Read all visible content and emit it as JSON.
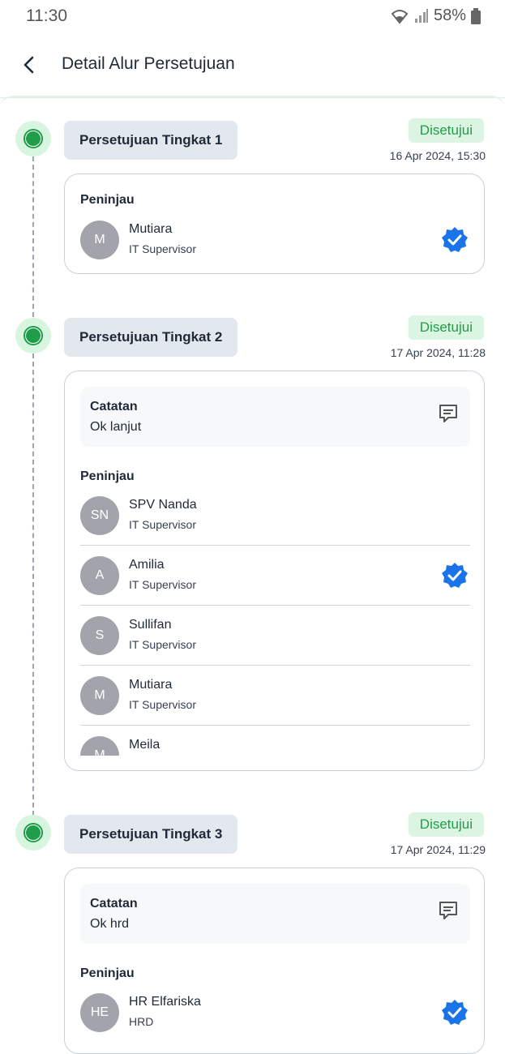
{
  "status_bar": {
    "time": "11:30",
    "battery": "58%"
  },
  "header": {
    "title": "Detail Alur Persetujuan"
  },
  "levels": [
    {
      "title": "Persetujuan Tingkat 1",
      "status": "Disetujui",
      "timestamp": "16 Apr 2024, 15:30",
      "reviewers_label": "Peninjau",
      "reviewers": [
        {
          "initials": "M",
          "name": "Mutiara",
          "role": "IT Supervisor",
          "approved": true
        }
      ]
    },
    {
      "title": "Persetujuan Tingkat 2",
      "status": "Disetujui",
      "timestamp": "17 Apr 2024, 11:28",
      "note_label": "Catatan",
      "note": "Ok lanjut",
      "reviewers_label": "Peninjau",
      "reviewers": [
        {
          "initials": "SN",
          "name": "SPV Nanda",
          "role": "IT Supervisor",
          "approved": false
        },
        {
          "initials": "A",
          "name": "Amilia",
          "role": "IT Supervisor",
          "approved": true
        },
        {
          "initials": "S",
          "name": "Sullifan",
          "role": "IT Supervisor",
          "approved": false
        },
        {
          "initials": "M",
          "name": "Mutiara",
          "role": "IT Supervisor",
          "approved": false
        },
        {
          "initials": "M",
          "name": "Meila",
          "role": "",
          "approved": false
        }
      ]
    },
    {
      "title": "Persetujuan Tingkat 3",
      "status": "Disetujui",
      "timestamp": "17 Apr 2024, 11:29",
      "note_label": "Catatan",
      "note": "Ok hrd",
      "reviewers_label": "Peninjau",
      "reviewers": [
        {
          "initials": "HE",
          "name": "HR Elfariska",
          "role": "HRD",
          "approved": true
        }
      ]
    }
  ],
  "colors": {
    "approved_green": "#1f9d49",
    "badge_bg": "#dcf5e3",
    "verified_blue": "#1a73e8"
  }
}
